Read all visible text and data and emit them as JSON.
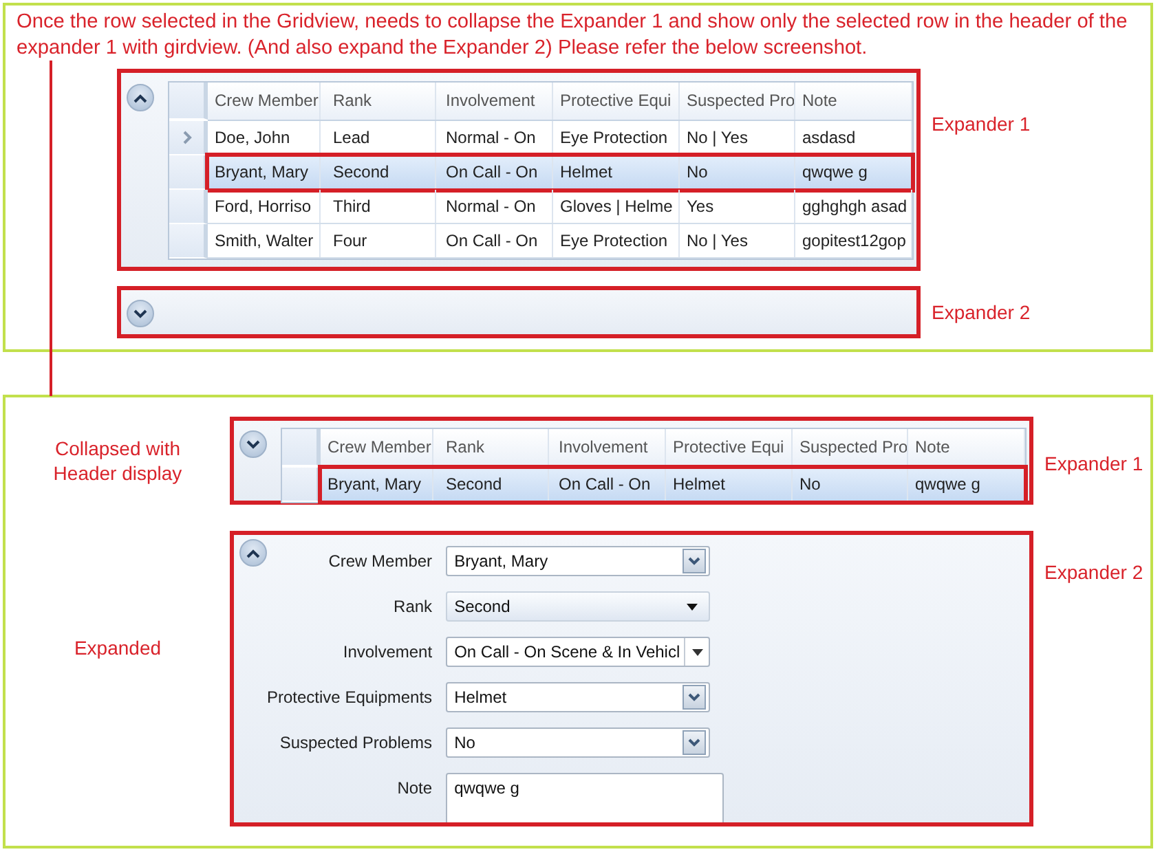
{
  "instruction": "Once the row selected in the Gridview, needs to collapse the Expander 1 and show only the selected row in the header of the expander 1 with girdview. (And also expand the Expander 2) Please refer the below screenshot.",
  "panels": [
    {
      "expanders": [
        {
          "label": "Expander 1",
          "expanded": true,
          "grid": {
            "columns": [
              "Crew Member",
              "Rank",
              "Involvement",
              "Protective Equi",
              "Suspected Pro",
              "Note"
            ],
            "rows": [
              {
                "current": true,
                "selected": false,
                "cells": [
                  "Doe, John",
                  "Lead",
                  "Normal - On",
                  "Eye Protection",
                  "No | Yes",
                  "asdasd"
                ]
              },
              {
                "current": false,
                "selected": true,
                "cells": [
                  "Bryant, Mary",
                  "Second",
                  "On Call - On",
                  "Helmet",
                  "No",
                  "qwqwe g"
                ]
              },
              {
                "current": false,
                "selected": false,
                "cells": [
                  "Ford, Horriso",
                  "Third",
                  "Normal - On",
                  "Gloves | Helme",
                  "Yes",
                  "gghghgh asad"
                ]
              },
              {
                "current": false,
                "selected": false,
                "cells": [
                  "Smith, Walter",
                  "Four",
                  "On Call - On",
                  "Eye Protection",
                  "No | Yes",
                  "gopitest12gop"
                ]
              }
            ]
          }
        },
        {
          "label": "Expander 2",
          "expanded": false
        }
      ]
    },
    {
      "expanders": [
        {
          "label": "Expander 1",
          "side_note": "Collapsed with Header display",
          "expanded": false,
          "grid": {
            "columns": [
              "Crew Member",
              "Rank",
              "Involvement",
              "Protective Equi",
              "Suspected Pro",
              "Note"
            ],
            "rows": [
              {
                "current": false,
                "selected": true,
                "cells": [
                  "Bryant, Mary",
                  "Second",
                  "On Call - On",
                  "Helmet",
                  "No",
                  "qwqwe g"
                ]
              }
            ]
          }
        },
        {
          "label": "Expander 2",
          "side_note": "Expanded",
          "expanded": true,
          "form": [
            {
              "label": "Crew Member",
              "kind": "combo",
              "value": "Bryant, Mary"
            },
            {
              "label": "Rank",
              "kind": "dropdown",
              "value": "Second"
            },
            {
              "label": "Involvement",
              "kind": "split",
              "value": "On Call - On Scene & In Vehicl"
            },
            {
              "label": "Protective Equipments",
              "kind": "combo",
              "value": "Helmet"
            },
            {
              "label": "Suspected Problems",
              "kind": "combo",
              "value": "No"
            },
            {
              "label": "Note",
              "kind": "textarea",
              "value": "qwqwe g"
            }
          ]
        }
      ]
    }
  ]
}
